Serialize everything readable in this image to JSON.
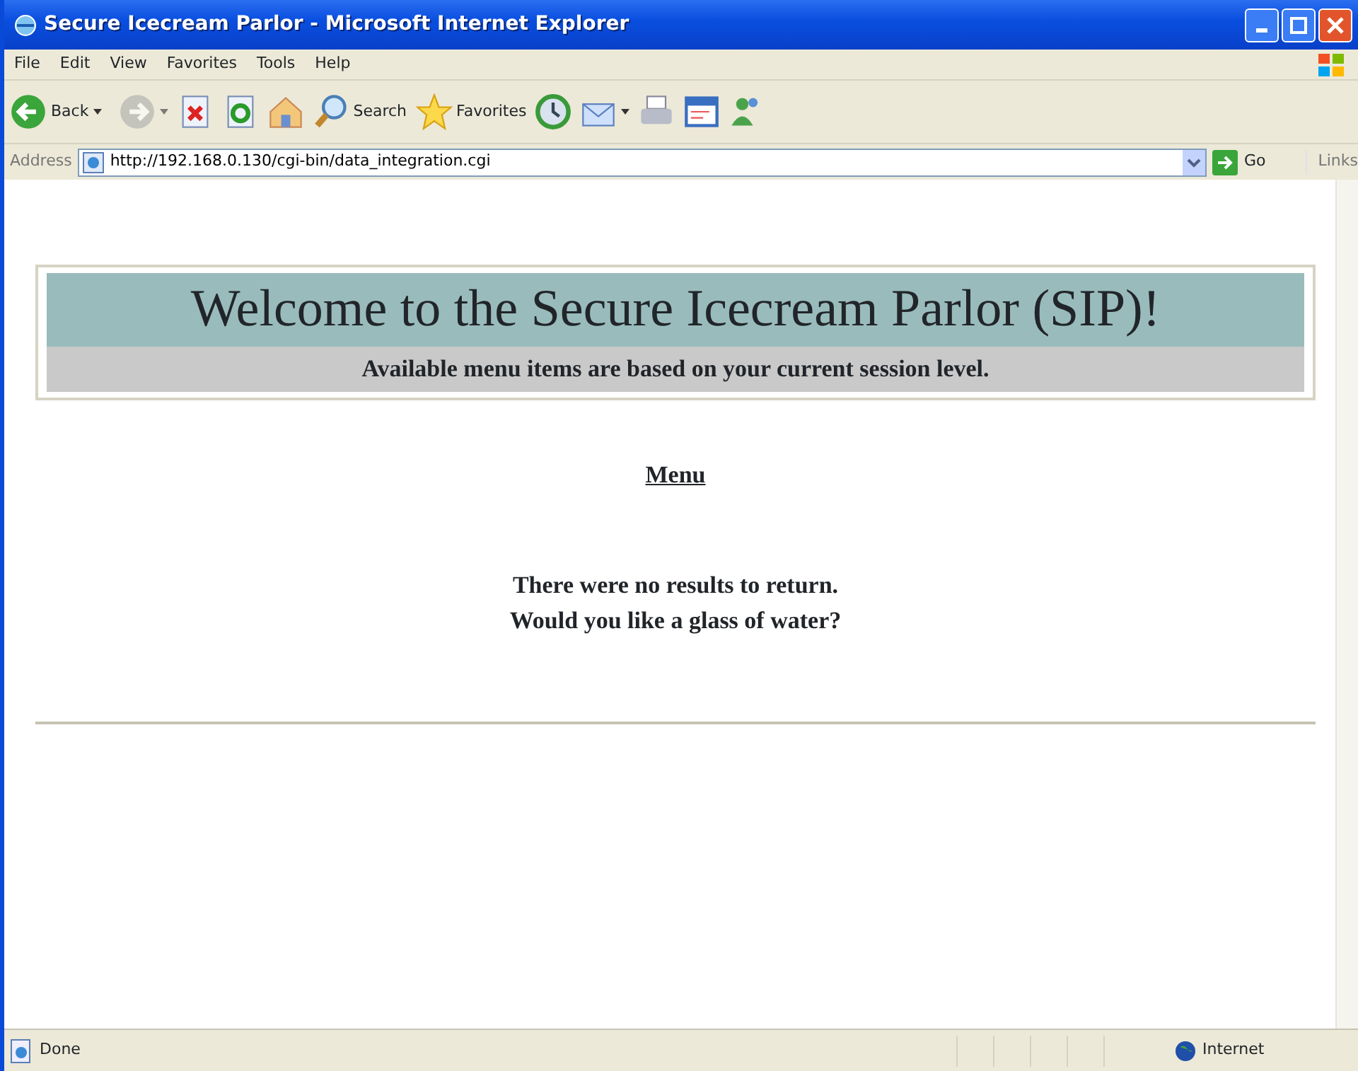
{
  "window": {
    "title": "Secure Icecream Parlor - Microsoft Internet Explorer"
  },
  "menu": [
    "File",
    "Edit",
    "View",
    "Favorites",
    "Tools",
    "Help"
  ],
  "toolbar": [
    {
      "kind": "back",
      "label": "Back",
      "disabled": false
    },
    {
      "kind": "forward",
      "disabled": true
    },
    {
      "kind": "stop"
    },
    {
      "kind": "refresh"
    },
    {
      "kind": "home"
    },
    {
      "kind": "search",
      "label": "Search"
    },
    {
      "kind": "favorites",
      "label": "Favorites"
    },
    {
      "kind": "history"
    },
    {
      "kind": "mail"
    },
    {
      "kind": "print"
    },
    {
      "kind": "edit"
    },
    {
      "kind": "messenger"
    }
  ],
  "address": {
    "label": "Address",
    "value": "http://192.168.0.130/cgi-bin/data_integration.cgi",
    "go": "Go",
    "links": "Links"
  },
  "page": {
    "heading": "Welcome to the Secure Icecream Parlor (SIP)!",
    "subheading": "Available menu items are based on your current session level.",
    "menu_link": "Menu",
    "messages": [
      "There were no results to return.",
      "Would you like a glass of water?"
    ]
  },
  "status_bar": {
    "text": "Done",
    "zone": "Internet"
  }
}
